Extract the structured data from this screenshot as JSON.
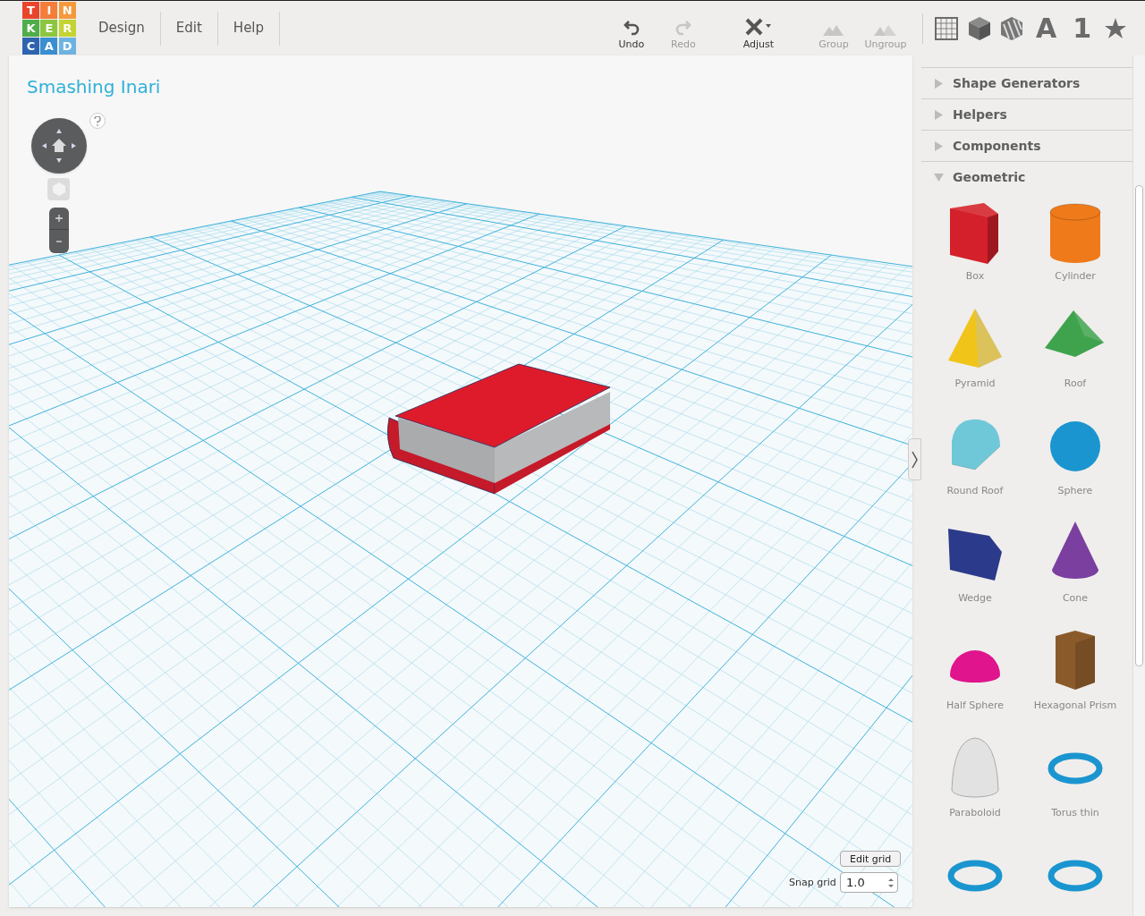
{
  "logo": [
    {
      "letter": "T",
      "color": "#e8452c"
    },
    {
      "letter": "I",
      "color": "#f47d3a"
    },
    {
      "letter": "N",
      "color": "#f59a3c"
    },
    {
      "letter": "K",
      "color": "#4fad4a"
    },
    {
      "letter": "E",
      "color": "#8cc63f"
    },
    {
      "letter": "R",
      "color": "#c4d433"
    },
    {
      "letter": "C",
      "color": "#2d64b0"
    },
    {
      "letter": "A",
      "color": "#3a8ed2"
    },
    {
      "letter": "D",
      "color": "#6db3e2"
    }
  ],
  "menu": [
    {
      "label": "Design"
    },
    {
      "label": "Edit"
    },
    {
      "label": "Help"
    }
  ],
  "toolbar": [
    {
      "kind": "undo",
      "label": "Undo",
      "disabled": false
    },
    {
      "kind": "redo",
      "label": "Redo",
      "disabled": true
    },
    {
      "kind": "adjust",
      "label": "Adjust",
      "disabled": false
    },
    {
      "kind": "group",
      "label": "Group",
      "disabled": true
    },
    {
      "kind": "ungroup",
      "label": "Ungroup",
      "disabled": true
    }
  ],
  "view_buttons": [
    {
      "kind": "grid"
    },
    {
      "kind": "box"
    },
    {
      "kind": "striped-box"
    },
    {
      "kind": "text",
      "label": "A"
    },
    {
      "kind": "text",
      "label": "1"
    },
    {
      "kind": "star"
    }
  ],
  "design": {
    "title": "Smashing Inari"
  },
  "snap": {
    "button": "Edit grid",
    "label": "Snap grid",
    "value": "1.0"
  },
  "sidebar": {
    "categories": [
      {
        "label": "Shape Generators",
        "expanded": false
      },
      {
        "label": "Helpers",
        "expanded": false
      },
      {
        "label": "Components",
        "expanded": false
      },
      {
        "label": "Geometric",
        "expanded": true,
        "shapes": [
          {
            "kind": "box",
            "label": "Box",
            "color": "#d4202a"
          },
          {
            "kind": "cylinder",
            "label": "Cylinder",
            "color": "#ee7a1a"
          },
          {
            "kind": "pyramid",
            "label": "Pyramid",
            "color": "#f0c419"
          },
          {
            "kind": "roof",
            "label": "Roof",
            "color": "#3fa34d"
          },
          {
            "kind": "round-roof",
            "label": "Round Roof",
            "color": "#6fc8d8"
          },
          {
            "kind": "sphere",
            "label": "Sphere",
            "color": "#1a95d0"
          },
          {
            "kind": "wedge",
            "label": "Wedge",
            "color": "#2b3a8a"
          },
          {
            "kind": "cone",
            "label": "Cone",
            "color": "#7b3fa0"
          },
          {
            "kind": "half-sphere",
            "label": "Half Sphere",
            "color": "#e0148c"
          },
          {
            "kind": "prism",
            "label": "Hexagonal Prism",
            "color": "#8b5a2b"
          },
          {
            "kind": "paraboloid",
            "label": "Paraboloid",
            "color": "#e2e2e2"
          },
          {
            "kind": "torus",
            "label": "Torus thin",
            "color": "#1a95d0"
          },
          {
            "kind": "torus",
            "color": "#1a95d0"
          },
          {
            "kind": "torus",
            "color": "#1a95d0"
          }
        ]
      }
    ]
  }
}
